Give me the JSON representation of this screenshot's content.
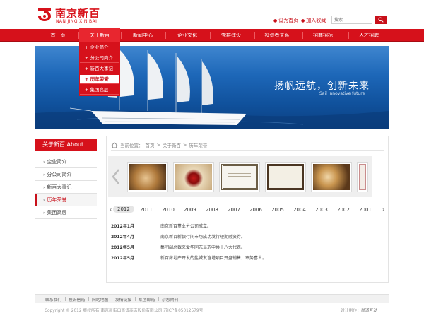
{
  "brand": {
    "name_cn": "南京新百",
    "name_en": "NAN JING XIN BAI",
    "color": "#d6111b"
  },
  "top_links": {
    "home": "设为首页",
    "favorite": "加入收藏",
    "search_placeholder": "搜索"
  },
  "nav": {
    "items": [
      "首　页",
      "关于新百",
      "新闻中心",
      "企业文化",
      "党群建设",
      "投资者关系",
      "招商招标",
      "人才招聘"
    ],
    "active": "关于新百",
    "dropdown": [
      "+ 企业简介",
      "+ 分公司简介",
      "+ 新百大事记",
      "+ 历年荣誉",
      "+ 集团高层"
    ],
    "dropdown_active": "+ 历年荣誉"
  },
  "banner": {
    "slogan": "扬帆远航，创新未来",
    "slogan_en": "Sail Innovative future"
  },
  "sidebar": {
    "title": "关于新百 About",
    "items": [
      "企业简介",
      "分公司简介",
      "新百大事记",
      "历年荣誉",
      "集团高层"
    ],
    "active": "历年荣誉"
  },
  "breadcrumb": {
    "label": "当前位置：",
    "parts": [
      "首页",
      "关于新百",
      "历年荣誉"
    ],
    "separator": ">"
  },
  "gallery": {
    "thumbs": [
      "photo-coin",
      "photo-seal",
      "certificate",
      "certificate-framed",
      "photo-coin-gold",
      "certificate-red"
    ]
  },
  "years": {
    "items": [
      "2012",
      "2011",
      "2010",
      "2009",
      "2008",
      "2007",
      "2006",
      "2005",
      "2004",
      "2003",
      "2002",
      "2001"
    ],
    "active": "2012"
  },
  "events": [
    {
      "date": "2012年1月",
      "text": "南京新百董业分公司成立。"
    },
    {
      "date": "2012年4月",
      "text": "南京新百新银行间市场成功发行短期融资券。"
    },
    {
      "date": "2012年5月",
      "text": "集团副总裁来爱华同志当选中共十八大代表。"
    },
    {
      "date": "2012年5月",
      "text": "新百房地产开发的盐城友谊塔项目开盘销售，市势喜人。"
    }
  ],
  "footer": {
    "links": [
      "联系我们",
      "投诉信箱",
      "网站地图",
      "友情链接",
      "集团邮箱",
      "杂志期刊"
    ],
    "copyright": "Copyright © 2012 版权所有 南京新街口百货商店股份有限公司 苏ICP备05012579号",
    "design_label": "设计制作：",
    "design_by": "尚道互动"
  }
}
